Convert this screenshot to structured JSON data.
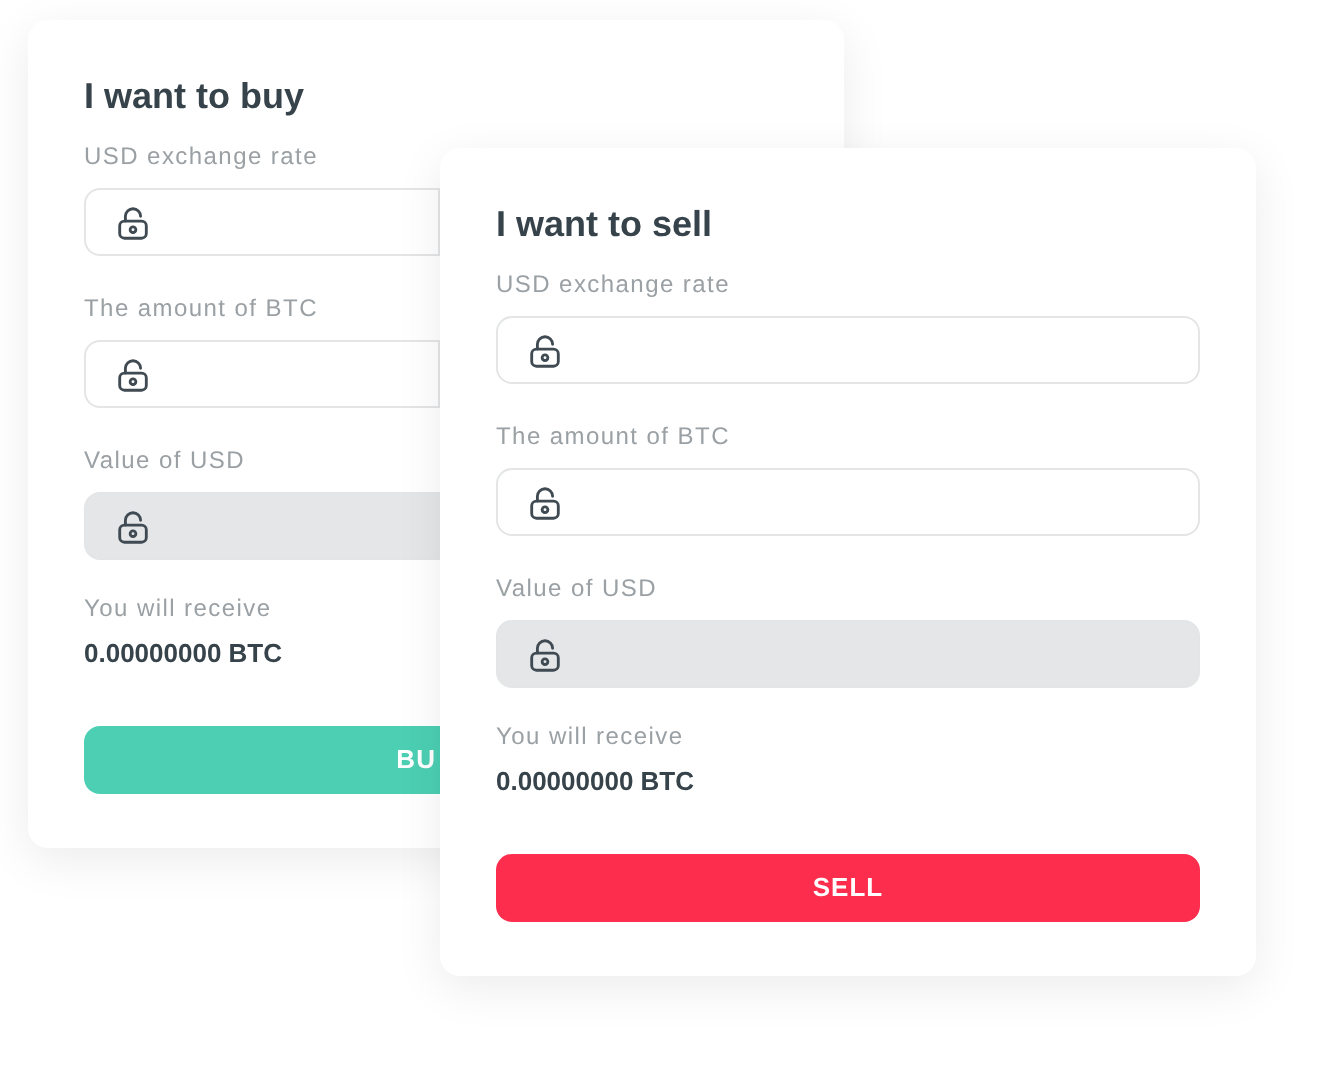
{
  "cards": [
    {
      "title": "I want to buy",
      "fields": [
        {
          "label": "USD exchange rate",
          "disabled": false
        },
        {
          "label": "The amount of BTC",
          "disabled": false
        },
        {
          "label": "Value of USD",
          "disabled": true
        }
      ],
      "receive_label": "You will receive",
      "receive_value": "0.00000000 BTC",
      "button": {
        "label": "BU",
        "color": "#4ccfb3"
      }
    },
    {
      "title": "I want to sell",
      "fields": [
        {
          "label": "USD exchange rate",
          "disabled": false
        },
        {
          "label": "The amount of BTC",
          "disabled": false
        },
        {
          "label": "Value of USD",
          "disabled": true
        }
      ],
      "receive_label": "You will receive",
      "receive_value": "0.00000000 BTC",
      "button": {
        "label": "SELL",
        "color": "#fc2d4d"
      }
    }
  ]
}
